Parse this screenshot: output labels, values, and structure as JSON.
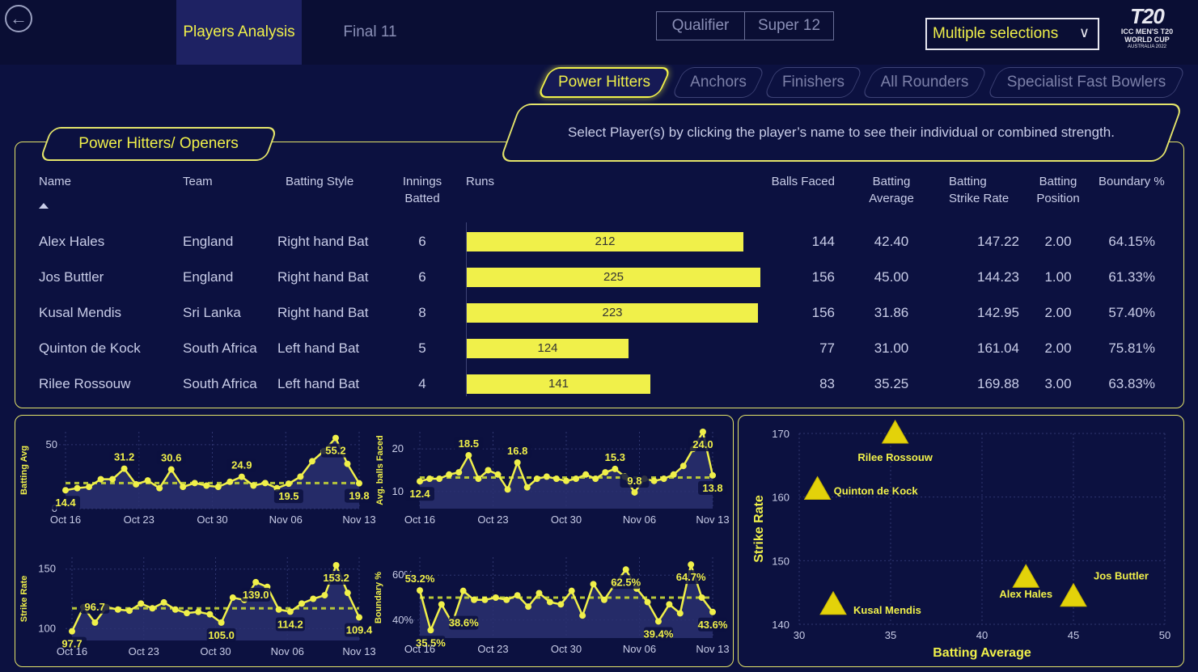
{
  "nav": {
    "back_icon": "back-arrow-icon",
    "tabs": [
      {
        "label": "Players Analysis"
      },
      {
        "label": "Final 11"
      }
    ],
    "stages": [
      {
        "label": "Qualifier"
      },
      {
        "label": "Super 12"
      }
    ],
    "dropdown": {
      "value": "Multiple selections"
    },
    "logo": {
      "mark": "T20",
      "line1": "ICC MEN'S T20",
      "line2": "WORLD CUP",
      "line3": "AUSTRALIA 2022"
    }
  },
  "categories": [
    "Power Hitters",
    "Anchors",
    "Finishers",
    "All Rounders",
    "Specialist Fast Bowlers"
  ],
  "instruction": "Select Player(s) by clicking the player’s name to see their individual or combined strength.",
  "section_title": "Power Hitters/ Openers",
  "table": {
    "headers": {
      "name": "Name",
      "team": "Team",
      "style": "Batting Style",
      "innings_1": "Innings",
      "innings_2": "Batted",
      "runs": "Runs",
      "balls": "Balls Faced",
      "avg_1": "Batting",
      "avg_2": "Average",
      "sr_1": "Batting",
      "sr_2": "Strike Rate",
      "pos_1": "Batting",
      "pos_2": "Position",
      "boundary": "Boundary %"
    },
    "runs_max": 225,
    "rows": [
      {
        "name": "Alex Hales",
        "team": "England",
        "style": "Right hand Bat",
        "innings": "6",
        "runs": 212,
        "runs_label": "212",
        "balls": "144",
        "avg": "42.40",
        "sr": "147.22",
        "pos": "2.00",
        "boundary": "64.15%"
      },
      {
        "name": "Jos Buttler",
        "team": "England",
        "style": "Right hand Bat",
        "innings": "6",
        "runs": 225,
        "runs_label": "225",
        "balls": "156",
        "avg": "45.00",
        "sr": "144.23",
        "pos": "1.00",
        "boundary": "61.33%"
      },
      {
        "name": "Kusal Mendis",
        "team": "Sri Lanka",
        "style": "Right hand Bat",
        "innings": "8",
        "runs": 223,
        "runs_label": "223",
        "balls": "156",
        "avg": "31.86",
        "sr": "142.95",
        "pos": "2.00",
        "boundary": "57.40%"
      },
      {
        "name": "Quinton de Kock",
        "team": "South Africa",
        "style": "Left hand Bat",
        "innings": "5",
        "runs": 124,
        "runs_label": "124",
        "balls": "77",
        "avg": "31.00",
        "sr": "161.04",
        "pos": "2.00",
        "boundary": "75.81%"
      },
      {
        "name": "Rilee Rossouw",
        "team": "South Africa",
        "style": "Left hand Bat",
        "innings": "4",
        "runs": 141,
        "runs_label": "141",
        "balls": "83",
        "avg": "35.25",
        "sr": "169.88",
        "pos": "3.00",
        "boundary": "63.83%"
      }
    ]
  },
  "chart_data": [
    {
      "type": "line",
      "ylabel": "Batting Avg",
      "xticks": [
        "Oct 16",
        "Oct 23",
        "Oct 30",
        "Nov 06",
        "Nov 13"
      ],
      "ylim": [
        0,
        60
      ],
      "yticks": [
        0,
        50
      ],
      "average_line": 20,
      "values": [
        14.4,
        16,
        17,
        23,
        23,
        31.2,
        19,
        22,
        16,
        30.6,
        17,
        20,
        18,
        17,
        21,
        24.9,
        18,
        20,
        16,
        19.5,
        25,
        37,
        45,
        55.2,
        35,
        19.8
      ],
      "labels": [
        {
          "i": 0,
          "text": "14.4",
          "pos": "below"
        },
        {
          "i": 5,
          "text": "31.2",
          "pos": "above"
        },
        {
          "i": 9,
          "text": "30.6",
          "pos": "above"
        },
        {
          "i": 15,
          "text": "24.9",
          "pos": "above"
        },
        {
          "i": 19,
          "text": "19.5",
          "pos": "below"
        },
        {
          "i": 23,
          "text": "55.2",
          "pos": "below"
        },
        {
          "i": 25,
          "text": "19.8",
          "pos": "below"
        }
      ]
    },
    {
      "type": "line",
      "ylabel": "Avg. balls Faced",
      "xticks": [
        "Oct 16",
        "Oct 23",
        "Oct 30",
        "Nov 06",
        "Nov 13"
      ],
      "ylim": [
        6,
        24
      ],
      "yticks": [
        10,
        20
      ],
      "average_line": 13.3,
      "values": [
        12.4,
        13,
        13,
        14,
        14.5,
        18.5,
        13,
        15,
        14,
        10.5,
        16.8,
        11,
        13,
        13.5,
        13,
        12.5,
        13,
        14,
        13,
        14.5,
        15.3,
        13.5,
        9.8,
        13,
        12.5,
        13,
        14,
        16,
        20,
        24,
        13.8
      ],
      "labels": [
        {
          "i": 0,
          "text": "12.4",
          "pos": "below"
        },
        {
          "i": 5,
          "text": "18.5",
          "pos": "above"
        },
        {
          "i": 10,
          "text": "16.8",
          "pos": "above"
        },
        {
          "i": 20,
          "text": "15.3",
          "pos": "above"
        },
        {
          "i": 22,
          "text": "9.8",
          "pos": "above"
        },
        {
          "i": 29,
          "text": "24.0",
          "pos": "below"
        },
        {
          "i": 30,
          "text": "13.8",
          "pos": "below"
        }
      ]
    },
    {
      "type": "line",
      "ylabel": "Strike Rate",
      "xticks": [
        "Oct 16",
        "Oct 23",
        "Oct 30",
        "Nov 06",
        "Nov 13"
      ],
      "ylim": [
        90,
        160
      ],
      "yticks": [
        100,
        150
      ],
      "average_line": 117,
      "values": [
        97.7,
        118,
        105,
        118,
        116,
        115,
        121,
        117,
        122,
        116,
        113,
        114,
        112,
        105.0,
        126,
        124,
        139.0,
        135,
        116,
        114.2,
        121,
        125,
        128,
        153.2,
        130,
        109.4
      ],
      "labels": [
        {
          "i": 0,
          "text": "97.7",
          "pos": "below"
        },
        {
          "i": 1,
          "text": "96.7",
          "pos": "side"
        },
        {
          "i": 13,
          "text": "105.0",
          "pos": "below"
        },
        {
          "i": 16,
          "text": "139.0",
          "pos": "below"
        },
        {
          "i": 19,
          "text": "114.2",
          "pos": "below"
        },
        {
          "i": 23,
          "text": "153.2",
          "pos": "below"
        },
        {
          "i": 25,
          "text": "109.4",
          "pos": "below"
        }
      ]
    },
    {
      "type": "line",
      "ylabel": "Boundary %",
      "xticks": [
        "Oct 16",
        "Oct 23",
        "Oct 30",
        "Nov 06",
        "Nov 13"
      ],
      "ylim": [
        32,
        68
      ],
      "yticks": [
        40,
        60
      ],
      "yticklabels": [
        "40%",
        "60%"
      ],
      "average_line": 50,
      "values": [
        53.2,
        35.5,
        47,
        38.6,
        53,
        49,
        49,
        50,
        49,
        51,
        46,
        52,
        48,
        47,
        53,
        42,
        56,
        49,
        56,
        62.5,
        54,
        48,
        39.4,
        47,
        43,
        64.7,
        50,
        43.6
      ],
      "labels": [
        {
          "i": 0,
          "text": "53.2%",
          "pos": "above"
        },
        {
          "i": 1,
          "text": "35.5%",
          "pos": "below"
        },
        {
          "i": 3,
          "text": "38.6%",
          "pos": "side"
        },
        {
          "i": 19,
          "text": "62.5%",
          "pos": "below"
        },
        {
          "i": 22,
          "text": "39.4%",
          "pos": "below"
        },
        {
          "i": 25,
          "text": "64.7%",
          "pos": "below"
        },
        {
          "i": 27,
          "text": "43.6%",
          "pos": "below"
        }
      ]
    },
    {
      "type": "scatter",
      "xlabel": "Batting Average",
      "ylabel": "Strike Rate",
      "xlim": [
        30,
        50
      ],
      "ylim": [
        140,
        170
      ],
      "xticks": [
        30,
        35,
        40,
        45,
        50
      ],
      "yticks": [
        140,
        150,
        160,
        170
      ],
      "points": [
        {
          "name": "Rilee Rossouw",
          "x": 35.25,
          "y": 169.88
        },
        {
          "name": "Quinton de Kock",
          "x": 31.0,
          "y": 161.04
        },
        {
          "name": "Jos Buttler",
          "x": 45.0,
          "y": 144.23
        },
        {
          "name": "Alex Hales",
          "x": 42.4,
          "y": 147.22
        },
        {
          "name": "Kusal Mendis",
          "x": 31.86,
          "y": 142.95
        }
      ]
    }
  ],
  "colors": {
    "accent": "#f0f04a",
    "background": "#0c1140",
    "panel_border": "#e4e46a",
    "text": "#c9cde8"
  }
}
